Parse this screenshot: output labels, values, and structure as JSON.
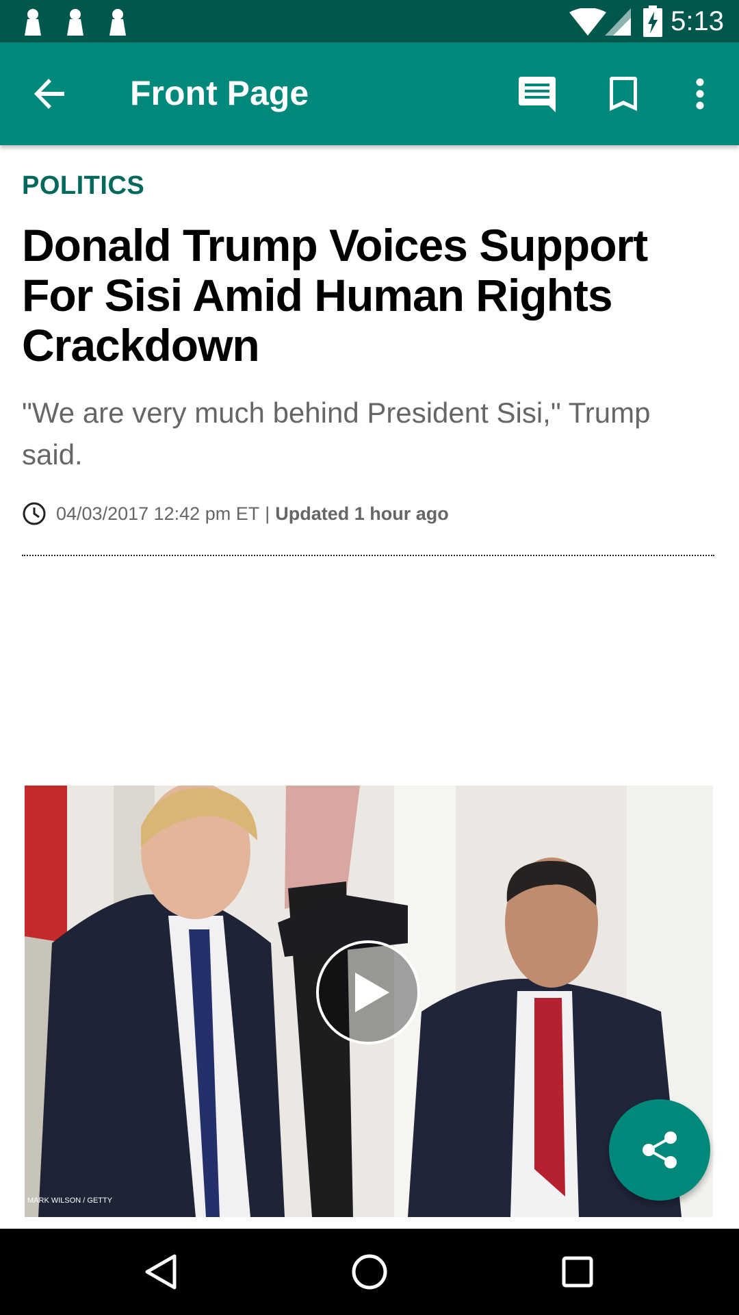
{
  "status_bar": {
    "time": "5:13",
    "icons": [
      "notification-icon",
      "notification-icon",
      "notification-icon",
      "wifi-icon",
      "signal-icon",
      "battery-charging-icon"
    ]
  },
  "app_bar": {
    "title": "Front Page",
    "actions": [
      "back-icon",
      "comments-icon",
      "bookmark-icon",
      "more-vert-icon"
    ]
  },
  "article": {
    "section": "POLITICS",
    "headline": "Donald Trump Voices Support For Sisi Amid Human Rights Crackdown",
    "subhead": "\"We are very much behind President Sisi,\" Trump said.",
    "timestamp": "04/03/2017 12:42 pm ET",
    "separator": "|",
    "updated": "Updated 1 hour ago",
    "video": {
      "credit": "MARK WILSON / GETTY",
      "play_icon": "play-icon"
    }
  },
  "fab": {
    "icon": "share-icon"
  },
  "nav_bar": {
    "icons": [
      "nav-back-icon",
      "nav-home-icon",
      "nav-recents-icon"
    ]
  },
  "colors": {
    "primary": "#00897b",
    "primary_dark": "#00574b",
    "section": "#00695c"
  }
}
